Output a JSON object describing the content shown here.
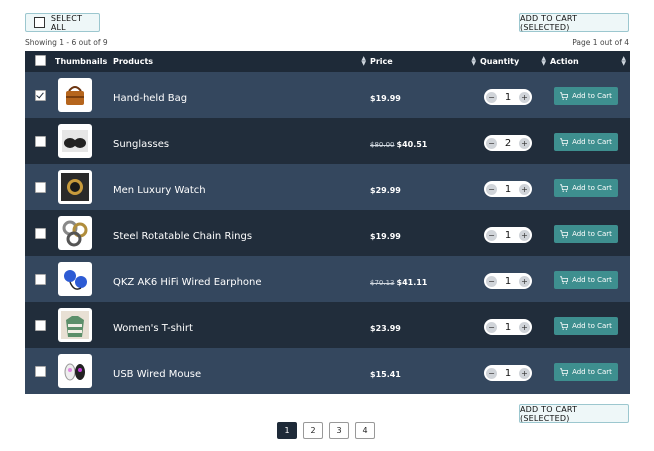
{
  "toolbar": {
    "select_all": "SELECT ALL",
    "add_to_cart_selected": "ADD TO CART (SELECTED)"
  },
  "summary": {
    "showing": "Showing 1 - 6 out of 9",
    "page_of": "Page 1 out of 4"
  },
  "table": {
    "headers": {
      "thumbnails": "Thumbnails",
      "products": "Products",
      "price": "Price",
      "quantity": "Quantity",
      "action": "Action"
    },
    "rows": [
      {
        "checked": true,
        "name": "Hand-held Bag",
        "old_price": "",
        "price": "$19.99",
        "qty": "1",
        "action": "Add to Cart"
      },
      {
        "checked": false,
        "name": "Sunglasses",
        "old_price": "$80.00",
        "price": "$40.51",
        "qty": "2",
        "action": "Add to Cart"
      },
      {
        "checked": false,
        "name": "Men Luxury Watch",
        "old_price": "",
        "price": "$29.99",
        "qty": "1",
        "action": "Add to Cart"
      },
      {
        "checked": false,
        "name": "Steel Rotatable Chain Rings",
        "old_price": "",
        "price": "$19.99",
        "qty": "1",
        "action": "Add to Cart"
      },
      {
        "checked": false,
        "name": "QKZ AK6 HiFi Wired Earphone",
        "old_price": "$70.13",
        "price": "$41.11",
        "qty": "1",
        "action": "Add to Cart"
      },
      {
        "checked": false,
        "name": "Women's T-shirt",
        "old_price": "",
        "price": "$23.99",
        "qty": "1",
        "action": "Add to Cart"
      },
      {
        "checked": false,
        "name": "USB Wired Mouse",
        "old_price": "",
        "price": "$15.41",
        "qty": "1",
        "action": "Add to Cart"
      }
    ]
  },
  "pagination": {
    "pages": [
      "1",
      "2",
      "3",
      "4"
    ],
    "current": "1"
  },
  "colors": {
    "header_bg": "#1e2a38",
    "row_odd": "#34475e",
    "row_even": "#212d3b",
    "accent": "#3e8f8f"
  }
}
